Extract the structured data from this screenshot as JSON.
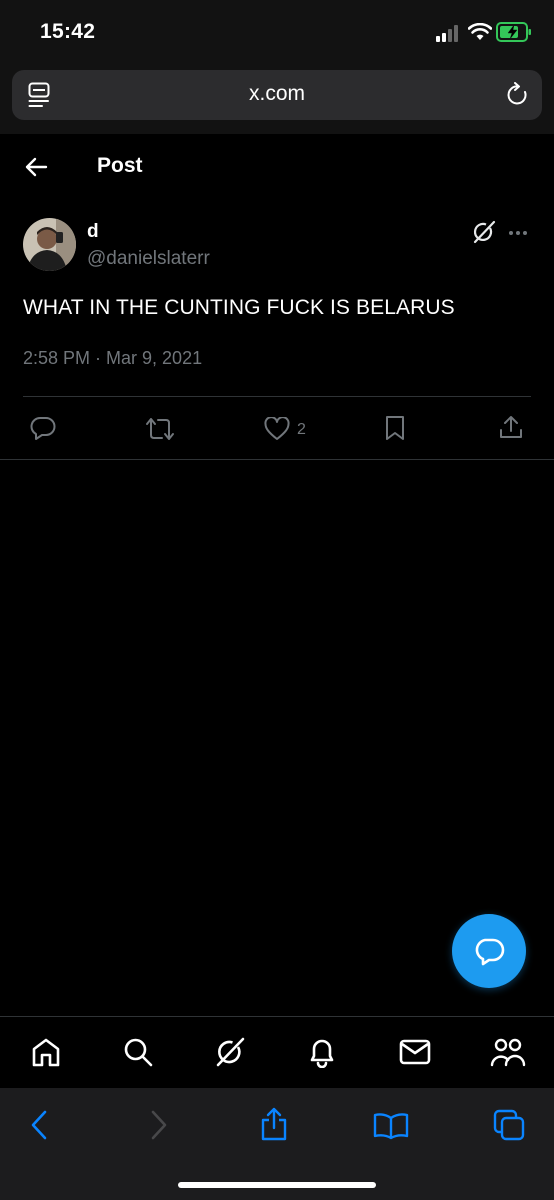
{
  "status_bar": {
    "time": "15:42"
  },
  "browser": {
    "url": "x.com"
  },
  "header": {
    "title": "Post"
  },
  "tweet": {
    "display_name": "d",
    "handle": "@danielslaterr",
    "text": "WHAT IN THE CUNTING FUCK IS BELARUS",
    "timestamp": "2:58 PM · Mar 9, 2021",
    "like_count": "2"
  },
  "colors": {
    "accent": "#1d9bf0",
    "background": "#000000",
    "secondary_text": "#71767b",
    "battery": "#34c759",
    "safari_blue": "#0a84ff"
  },
  "icons": {
    "reader": "reader-icon",
    "reload": "reload-icon",
    "back": "back-arrow-icon",
    "grok": "grok-icon",
    "more": "more-icon",
    "reply": "reply-icon",
    "retweet": "retweet-icon",
    "like": "like-icon",
    "bookmark": "bookmark-icon",
    "share": "share-icon",
    "home": "home-icon",
    "search": "search-icon",
    "notifications": "bell-icon",
    "messages": "mail-icon",
    "communities": "communities-icon"
  }
}
